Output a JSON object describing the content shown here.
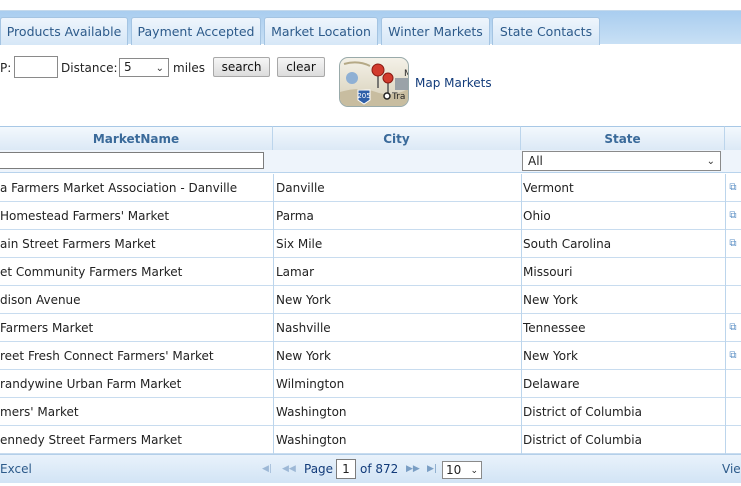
{
  "tabs": [
    "Products Available",
    "Payment Accepted",
    "Market Location",
    "Winter Markets",
    "State Contacts"
  ],
  "search": {
    "zip_label": "P:",
    "zip_value": "",
    "distance_label": "Distance:",
    "distance_value": "5",
    "miles_label": "miles",
    "search_button": "search",
    "clear_button": "clear"
  },
  "map": {
    "link_label": "Map Markets",
    "icon_text_shield": "205",
    "icon_text_fragment": "Tra",
    "icon_text_fragment2": "M"
  },
  "grid": {
    "columns": [
      "MarketName",
      "City",
      "State"
    ],
    "name_filter": "",
    "state_filter": "All",
    "rows": [
      {
        "name": "a Farmers Market Association - Danville",
        "city": "Danville",
        "state": "Vermont",
        "link": true
      },
      {
        "name": "Homestead Farmers' Market",
        "city": "Parma",
        "state": "Ohio",
        "link": true
      },
      {
        "name": "ain Street Farmers Market",
        "city": "Six Mile",
        "state": "South Carolina",
        "link": true
      },
      {
        "name": "et Community Farmers Market",
        "city": "Lamar",
        "state": "Missouri",
        "link": false
      },
      {
        "name": "dison Avenue",
        "city": "New York",
        "state": "New York",
        "link": false
      },
      {
        "name": " Farmers Market",
        "city": "Nashville",
        "state": "Tennessee",
        "link": true
      },
      {
        "name": "reet Fresh Connect Farmers' Market",
        "city": "New York",
        "state": "New York",
        "link": true
      },
      {
        "name": "randywine Urban Farm Market",
        "city": "Wilmington",
        "state": "Delaware",
        "link": false
      },
      {
        "name": "mers' Market",
        "city": "Washington",
        "state": "District of Columbia",
        "link": false
      },
      {
        "name": "ennedy Street Farmers Market",
        "city": "Washington",
        "state": "District of Columbia",
        "link": false
      }
    ]
  },
  "pager": {
    "excel_label": "Excel",
    "page_label": "Page",
    "page_value": "1",
    "of_label": "of 872",
    "page_size": "10",
    "view_label": "Vie"
  },
  "colors": {
    "accent": "#2c5a8a",
    "header_text": "#3a6a9a",
    "tabstrip": "#b9d7f2",
    "link": "#123b7a"
  }
}
